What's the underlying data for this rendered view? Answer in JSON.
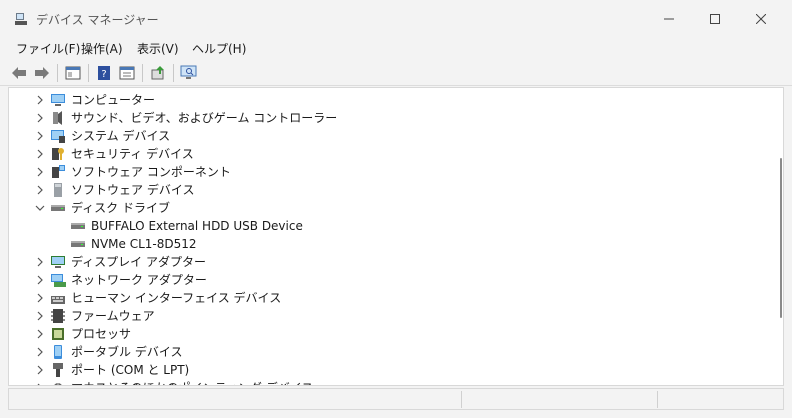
{
  "window": {
    "title": "デバイス マネージャー"
  },
  "menu": [
    {
      "label": "ファイル(F)"
    },
    {
      "label": "操作(A)"
    },
    {
      "label": "表示(V)"
    },
    {
      "label": "ヘルプ(H)"
    }
  ],
  "toolbar": [
    {
      "icon": "back-arrow-icon"
    },
    {
      "icon": "forward-arrow-icon"
    },
    {
      "icon": "show-hide-console-tree-icon"
    },
    {
      "icon": "help-icon"
    },
    {
      "icon": "properties-icon"
    },
    {
      "icon": "update-driver-icon"
    },
    {
      "icon": "scan-hardware-icon"
    }
  ],
  "tree": [
    {
      "label": "コンピューター",
      "icon": "computer-icon",
      "expanded": false,
      "level": 0
    },
    {
      "label": "サウンド、ビデオ、およびゲーム コントローラー",
      "icon": "speaker-icon",
      "expanded": false,
      "level": 0
    },
    {
      "label": "システム デバイス",
      "icon": "system-device-icon",
      "expanded": false,
      "level": 0
    },
    {
      "label": "セキュリティ デバイス",
      "icon": "security-device-icon",
      "expanded": false,
      "level": 0
    },
    {
      "label": "ソフトウェア コンポーネント",
      "icon": "software-component-icon",
      "expanded": false,
      "level": 0
    },
    {
      "label": "ソフトウェア デバイス",
      "icon": "software-device-icon",
      "expanded": false,
      "level": 0
    },
    {
      "label": "ディスク ドライブ",
      "icon": "disk-drive-icon",
      "expanded": true,
      "level": 0
    },
    {
      "label": "BUFFALO External HDD USB Device",
      "icon": "disk-drive-icon",
      "level": 1
    },
    {
      "label": "NVMe CL1-8D512",
      "icon": "disk-drive-icon",
      "level": 1
    },
    {
      "label": "ディスプレイ アダプター",
      "icon": "display-adapter-icon",
      "expanded": false,
      "level": 0
    },
    {
      "label": "ネットワーク アダプター",
      "icon": "network-adapter-icon",
      "expanded": false,
      "level": 0
    },
    {
      "label": "ヒューマン インターフェイス デバイス",
      "icon": "hid-icon",
      "expanded": false,
      "level": 0
    },
    {
      "label": "ファームウェア",
      "icon": "firmware-icon",
      "expanded": false,
      "level": 0
    },
    {
      "label": "プロセッサ",
      "icon": "processor-icon",
      "expanded": false,
      "level": 0
    },
    {
      "label": "ポータブル デバイス",
      "icon": "portable-device-icon",
      "expanded": false,
      "level": 0
    },
    {
      "label": "ポート (COM と LPT)",
      "icon": "port-icon",
      "expanded": false,
      "level": 0
    },
    {
      "label": "マウスとそのほかのポインティング デバイス",
      "icon": "mouse-icon",
      "expanded": false,
      "level": 0
    }
  ]
}
